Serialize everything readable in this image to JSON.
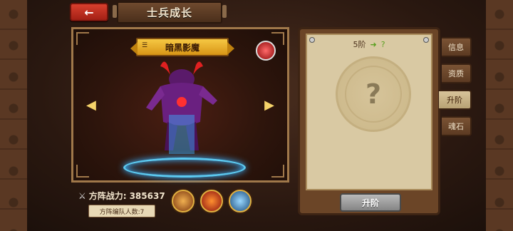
{
  "header": {
    "back_label": "←",
    "title": "士兵成长"
  },
  "unit": {
    "name": "暗黑影魔",
    "power_label": "方阵战力:",
    "power_value": "385637",
    "squad_label": "方阵编队人数:7",
    "skills": [
      "claw-skill-icon",
      "fire-skill-icon",
      "ice-skill-icon"
    ]
  },
  "upgrade_panel": {
    "tier_current": "5阶",
    "tier_arrow": "➜",
    "tier_next": "?",
    "unknown_mark": "?",
    "button_label": "升阶"
  },
  "tabs": [
    {
      "label": "信息",
      "active": false
    },
    {
      "label": "资质",
      "active": false
    },
    {
      "label": "升阶",
      "active": true
    },
    {
      "label": "魂石",
      "active": false
    }
  ],
  "colors": {
    "accent_gold": "#f6c843",
    "back_button_red": "#d8402e",
    "portal_blue": "#5cc9f0"
  }
}
